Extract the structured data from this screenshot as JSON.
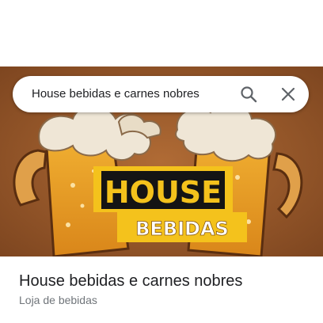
{
  "search": {
    "query": "House bebidas e carnes nobres"
  },
  "icons": {
    "search": "search-icon",
    "close": "close-icon"
  },
  "hero": {
    "logo_line1": "HOUSE",
    "logo_line2": "BEBIDAS",
    "colors": {
      "background": "#9a5a2a",
      "beer": "#e39a1e",
      "foam": "#efe6d6",
      "logo_yellow": "#f4c21c",
      "logo_black": "#141414"
    }
  },
  "place": {
    "title": "House bebidas e carnes nobres",
    "category": "Loja de bebidas"
  }
}
